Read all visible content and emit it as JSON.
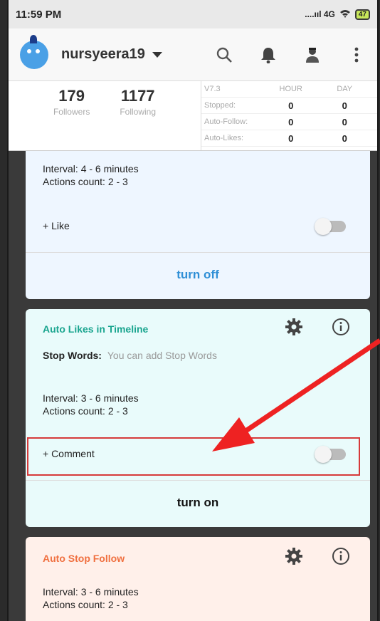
{
  "status_bar": {
    "time": "11:59 PM",
    "network": "....ııl 4G",
    "battery": "47"
  },
  "header": {
    "username": "nursyeera19"
  },
  "profile_stats": {
    "followers_count": "179",
    "followers_label": "Followers",
    "following_count": "1177",
    "following_label": "Following"
  },
  "activity_table": {
    "version": "V7.3",
    "col_hour": "HOUR",
    "col_day": "DAY",
    "rows": [
      {
        "label": "Stopped:",
        "hour": "0",
        "day": "0"
      },
      {
        "label": "Auto-Follow:",
        "hour": "0",
        "day": "0"
      },
      {
        "label": "Auto-Likes:",
        "hour": "0",
        "day": "0"
      }
    ]
  },
  "card1": {
    "interval": "Interval: 4 - 6 minutes",
    "actions": "Actions count: 2 - 3",
    "option": "+ Like",
    "action_label": "turn off"
  },
  "card2": {
    "title": "Auto Likes in Timeline",
    "stop_words_label": "Stop Words:",
    "stop_words_value": "You can add Stop Words",
    "interval": "Interval: 3 - 6 minutes",
    "actions": "Actions count: 2 - 3",
    "option": "+ Comment",
    "action_label": "turn on"
  },
  "card3": {
    "title": "Auto Stop Follow",
    "interval": "Interval: 3 - 6 minutes",
    "actions": "Actions count: 2 - 3"
  },
  "colors": {
    "accent_teal": "#1aa58f",
    "accent_orange": "#f07040",
    "action_blue": "#2f8fd6",
    "highlight_red": "#d63a3a"
  },
  "icons": [
    "search-icon",
    "bell-icon",
    "user-icon",
    "more-vert-icon",
    "gear-icon",
    "info-icon"
  ]
}
